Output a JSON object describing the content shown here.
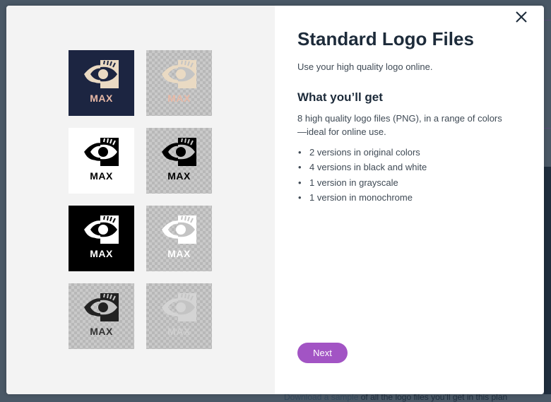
{
  "modal": {
    "title": "Standard Logo Files",
    "subtitle": "Use your high quality logo online.",
    "section_heading": "What you’ll get",
    "description": "8 high quality logo files (PNG), in a range of colors —ideal for online use.",
    "features": [
      "2 versions in original colors",
      "4 versions in black and white",
      "1 version in grayscale",
      "1 version in monochrome"
    ],
    "bullet": "•",
    "next_label": "Next",
    "close_icon": "close-icon"
  },
  "logo": {
    "brand_text": "MAX",
    "icon": "eye-icon",
    "variants": [
      {
        "name": "original-dark",
        "background": "navy",
        "icon_color": "#eadac3",
        "text_color": "#e8b9a6"
      },
      {
        "name": "original-transparent",
        "background": "transparent",
        "icon_color": "#eadac3",
        "text_color": "#e8b9a6"
      },
      {
        "name": "black-on-white",
        "background": "white",
        "icon_color": "#000000",
        "text_color": "#000000"
      },
      {
        "name": "black-transparent",
        "background": "transparent",
        "icon_color": "#000000",
        "text_color": "#000000"
      },
      {
        "name": "white-on-black",
        "background": "black",
        "icon_color": "#ffffff",
        "text_color": "#ffffff"
      },
      {
        "name": "white-transparent",
        "background": "transparent",
        "icon_color": "#ffffff",
        "text_color": "#ffffff"
      },
      {
        "name": "grayscale",
        "background": "transparent",
        "icon_color": "#222222",
        "text_color": "#333333"
      },
      {
        "name": "monochrome",
        "background": "transparent",
        "icon_color": "#d4d4d4",
        "text_color": "#cfcfcf"
      }
    ]
  },
  "background_page": {
    "download_link": "Download a sample",
    "download_rest": " of all the logo files you’ll get in this plan"
  },
  "colors": {
    "accent": "#a254c4",
    "heading": "#1d2b3a",
    "navy_tile": "#1c2541"
  }
}
